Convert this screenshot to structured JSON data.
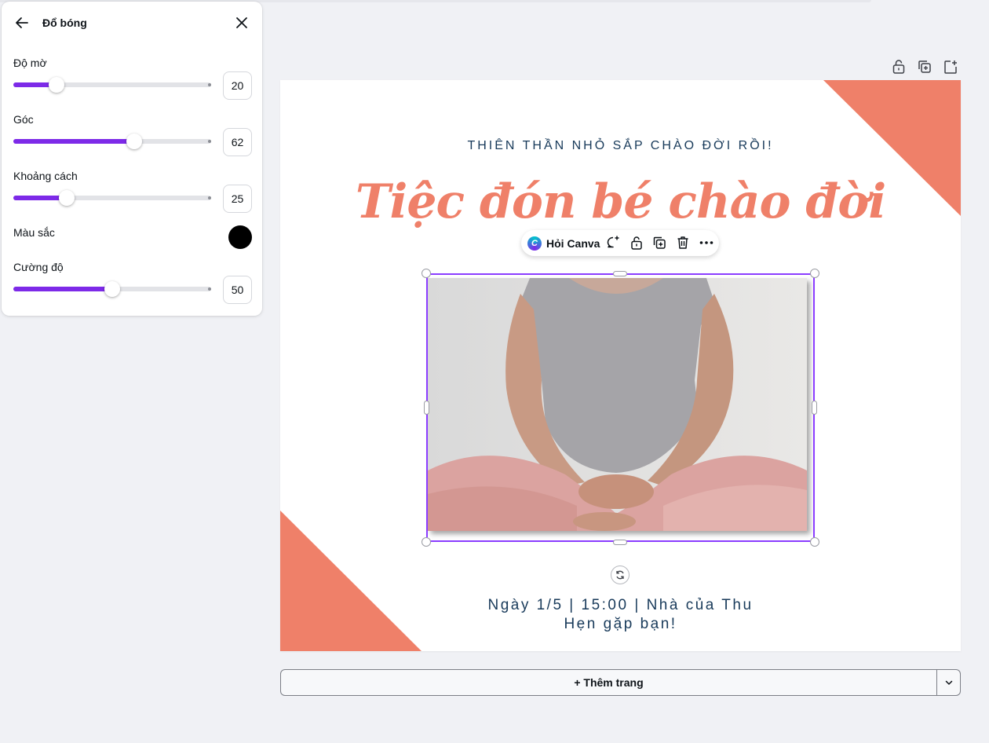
{
  "panel": {
    "title": "Đổ bóng",
    "sliders": [
      {
        "label": "Độ mờ",
        "value": "20",
        "fraction": 0.22
      },
      {
        "label": "Góc",
        "value": "62",
        "fraction": 0.61
      },
      {
        "label": "Khoảng cách",
        "value": "25",
        "fraction": 0.27
      },
      {
        "label": "Cường độ",
        "value": "50",
        "fraction": 0.5
      }
    ],
    "color_label": "Màu sắc",
    "color_value": "#000000"
  },
  "design": {
    "subtitle": "THIÊN THẦN NHỎ SẮP CHÀO ĐỜI RỒI!",
    "title": "Tiệc đón bé chào đời",
    "date_line": "Ngày 1/5 | 15:00 | Nhà của Thu",
    "see_you": "Hẹn gặp bạn!",
    "accent": "#ef8069",
    "text_color": "#183a5a"
  },
  "float_toolbar": {
    "ask_label": "Hỏi Canva"
  },
  "add_page": {
    "label": "+ Thêm trang"
  },
  "colors": {
    "brand_purple": "#7d2ae8",
    "selection": "#8b3dff"
  }
}
